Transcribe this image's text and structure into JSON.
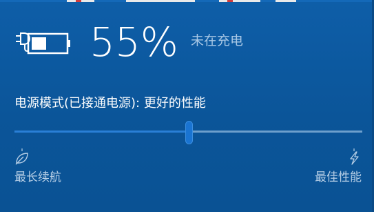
{
  "battery": {
    "percent_text": "55%",
    "level": 0.55,
    "status": "未在充电",
    "icon": "battery-not-charging-icon"
  },
  "power_mode": {
    "label": "电源模式(已接通电源): 更好的性能",
    "slider_value": 0.5,
    "min_label": "最长续航",
    "max_label": "最佳性能",
    "min_icon": "leaf-icon",
    "max_icon": "lightning-icon"
  },
  "colors": {
    "background": "#0d5aa0",
    "accent": "#1a74d2",
    "text": "#ffffff",
    "muted_text": "#a9c8e6"
  }
}
